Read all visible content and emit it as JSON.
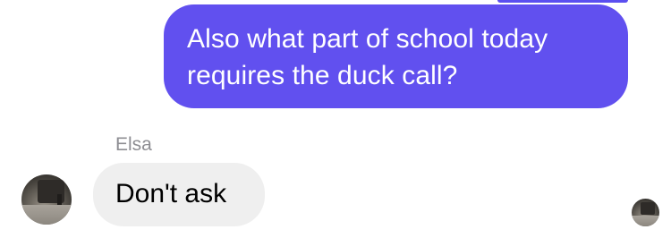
{
  "conversation": {
    "outgoing_message": {
      "line1": "Also what part of school today",
      "line2": "requires the duck call?"
    },
    "incoming_sender": "Elsa",
    "incoming_message": "Don't ask"
  },
  "colors": {
    "outgoing_bubble": "#6150ef",
    "incoming_bubble": "#efefef",
    "sender_name": "#8e8e93"
  }
}
